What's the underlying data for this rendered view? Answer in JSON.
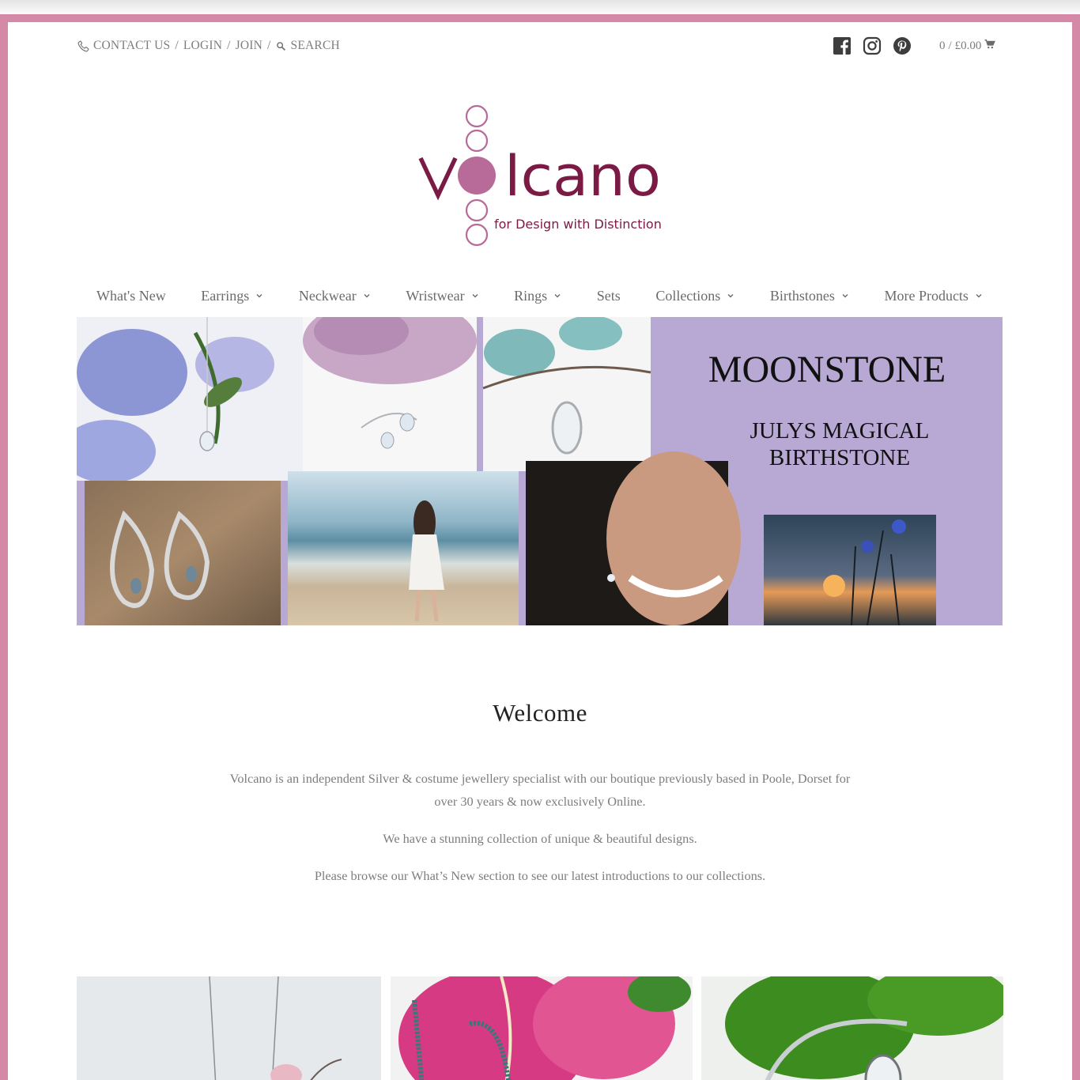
{
  "utility_bar": {
    "contact_label": "CONTACT US",
    "login_label": "LOGIN",
    "join_label": "JOIN",
    "search_label": "SEARCH",
    "separator": "/"
  },
  "social": {
    "icons": [
      "facebook-icon",
      "instagram-icon",
      "pinterest-icon"
    ]
  },
  "cart": {
    "count": "0",
    "separator": "/",
    "total": "£0.00",
    "icon": "cart-icon"
  },
  "logo": {
    "brand_name": "volcano",
    "tagline": "for Design with Distinction",
    "colors": {
      "brand": "#7b1a45",
      "accent": "#b86a98"
    }
  },
  "nav": {
    "items": [
      {
        "label": "What's New",
        "has_dropdown": false
      },
      {
        "label": "Earrings",
        "has_dropdown": true
      },
      {
        "label": "Neckwear",
        "has_dropdown": true
      },
      {
        "label": "Wristwear",
        "has_dropdown": true
      },
      {
        "label": "Rings",
        "has_dropdown": true
      },
      {
        "label": "Sets",
        "has_dropdown": false
      },
      {
        "label": "Collections",
        "has_dropdown": true
      },
      {
        "label": "Birthstones",
        "has_dropdown": true
      },
      {
        "label": "More Products",
        "has_dropdown": true
      }
    ]
  },
  "banner": {
    "title": "MOONSTONE",
    "subtitle_line1": "JULYS MAGICAL",
    "subtitle_line2": "BIRTHSTONE",
    "background": "#b7a9d4"
  },
  "welcome": {
    "title": "Welcome",
    "paragraphs": [
      "Volcano is an independent Silver & costume jewellery specialist with our boutique previously based in Poole, Dorset for over 30 years & now exclusively Online.",
      "We have a stunning collection of unique & beautiful designs.",
      "Please browse our What’s New section to see our latest introductions to our collections."
    ]
  },
  "theme": {
    "frame_color": "#d48aa6",
    "text_muted": "#7d7d7d",
    "nav_text": "#6b6b6b"
  }
}
